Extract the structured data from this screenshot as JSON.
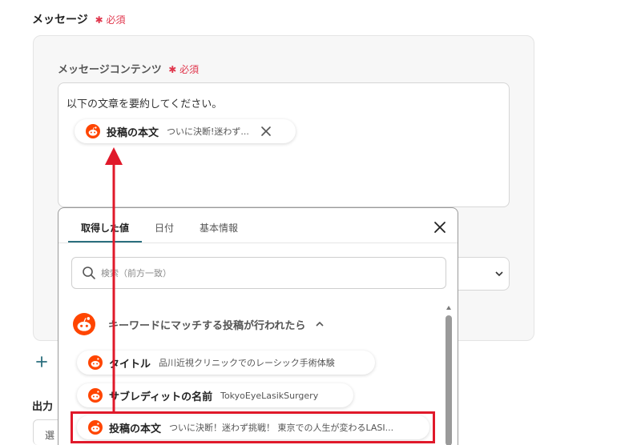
{
  "section": {
    "label": "メッセージ",
    "required": "必須"
  },
  "content": {
    "label": "メッセージコンテンツ",
    "required": "必須",
    "text": "以下の文章を要約してください。",
    "chip": {
      "title": "投稿の本文",
      "preview": "ついに決断!迷わず..."
    }
  },
  "panel": {
    "tabs": [
      {
        "label": "取得した値",
        "active": true
      },
      {
        "label": "日付",
        "active": false
      },
      {
        "label": "基本情報",
        "active": false
      }
    ],
    "search_placeholder": "検索（前方一致）",
    "group_title": "キーワードにマッチする投稿が行われたら",
    "items": [
      {
        "title": "タイトル",
        "value": "品川近視クリニックでのレーシック手術体験"
      },
      {
        "title": "サブレディットの名前",
        "value": "TokyoEyeLasikSurgery"
      },
      {
        "title": "投稿の本文",
        "value": "ついに決断！迷わず挑戦！ 東京での人生が変わるLASI..."
      }
    ]
  },
  "output": {
    "label": "出力",
    "select_value": "選"
  },
  "colors": {
    "accent": "#2b6f7e",
    "reddit": "#ff4500",
    "annotation": "#e0192a"
  },
  "icons": {
    "reddit": "reddit-icon",
    "close": "close-icon",
    "search": "search-icon",
    "plus": "plus-icon"
  }
}
